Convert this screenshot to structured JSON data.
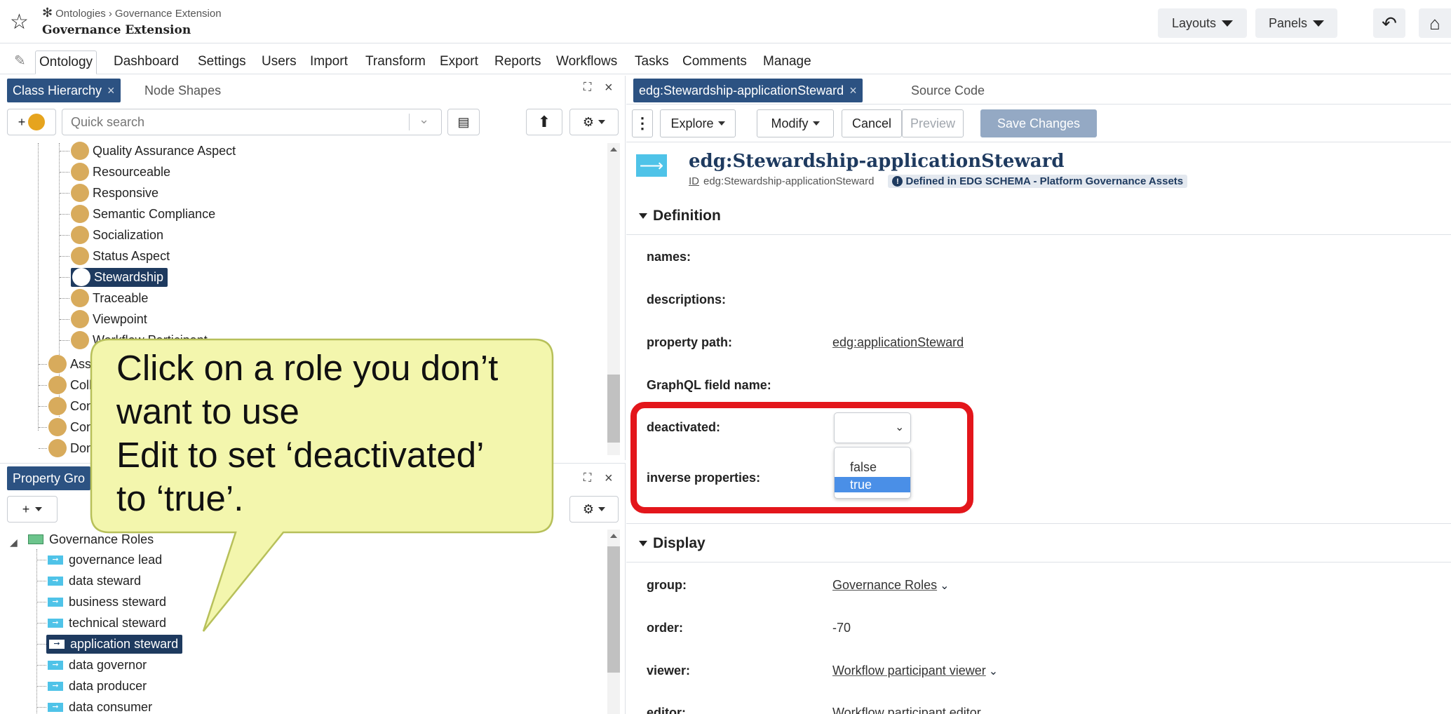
{
  "header": {
    "breadcrumb": [
      "Ontologies",
      "Governance Extension"
    ],
    "title": "Governance Extension",
    "layouts_label": "Layouts",
    "panels_label": "Panels"
  },
  "nav": {
    "tabs": [
      "Ontology",
      "Dashboard",
      "Settings",
      "Users",
      "Import",
      "Transform",
      "Export",
      "Reports",
      "Workflows",
      "Tasks",
      "Comments",
      "Manage"
    ],
    "active": "Ontology"
  },
  "class_panel": {
    "tab_active": "Class Hierarchy",
    "tab_other": "Node Shapes",
    "search_placeholder": "Quick search",
    "add_label": "+",
    "items": [
      {
        "label": "Quality Assurance Aspect"
      },
      {
        "label": "Resourceable"
      },
      {
        "label": "Responsive"
      },
      {
        "label": "Semantic Compliance"
      },
      {
        "label": "Socialization"
      },
      {
        "label": "Status Aspect"
      },
      {
        "label": "Stewardship",
        "selected": true
      },
      {
        "label": "Traceable"
      },
      {
        "label": "Viewpoint"
      },
      {
        "label": "Workflow Participant"
      }
    ],
    "root_items": [
      "Asse",
      "Coll",
      "Con",
      "Con",
      "Don"
    ]
  },
  "property_panel": {
    "tab_active": "Property Gro",
    "add_label": "+",
    "group": "Governance Roles",
    "items": [
      {
        "label": "governance lead"
      },
      {
        "label": "data steward"
      },
      {
        "label": "business steward"
      },
      {
        "label": "technical steward"
      },
      {
        "label": "application steward",
        "selected": true
      },
      {
        "label": "data governor"
      },
      {
        "label": "data producer"
      },
      {
        "label": "data consumer"
      }
    ]
  },
  "editor": {
    "tab_active": "edg:Stewardship-applicationSteward",
    "tab_other": "Source Code",
    "buttons": {
      "explore": "Explore",
      "modify": "Modify",
      "cancel": "Cancel",
      "preview": "Preview",
      "save": "Save Changes"
    },
    "resource_title": "edg:Stewardship-applicationSteward",
    "id_label": "ID",
    "id_value": "edg:Stewardship-applicationSteward",
    "defined_in": "Defined in EDG SCHEMA - Platform Governance Assets",
    "definition_header": "Definition",
    "fields": {
      "names": "names:",
      "descriptions": "descriptions:",
      "property_path": "property path:",
      "property_path_value": "edg:applicationSteward",
      "graphql": "GraphQL field name:",
      "deactivated": "deactivated:",
      "inverse": "inverse properties:"
    },
    "dropdown_options": [
      "false",
      "true"
    ],
    "dropdown_highlighted": "true",
    "display_header": "Display",
    "display": {
      "group": "group:",
      "group_value": "Governance Roles",
      "order": "order:",
      "order_value": "-70",
      "viewer": "viewer:",
      "viewer_value": "Workflow participant viewer",
      "editor": "editor:",
      "editor_value": "Workflow participant editor"
    }
  },
  "callout": {
    "lines": [
      "Click on a role you don’t",
      "want to use",
      "Edit to set ‘deactivated’",
      "to ‘true’."
    ]
  },
  "colors": {
    "active_tab": "#2c5282",
    "selection": "#1e3a5f",
    "class_circle": "#d8ab5c",
    "highlight_box": "#e3161b",
    "callout_fill": "#f3f6ad",
    "save_button": "#94a9c4"
  }
}
